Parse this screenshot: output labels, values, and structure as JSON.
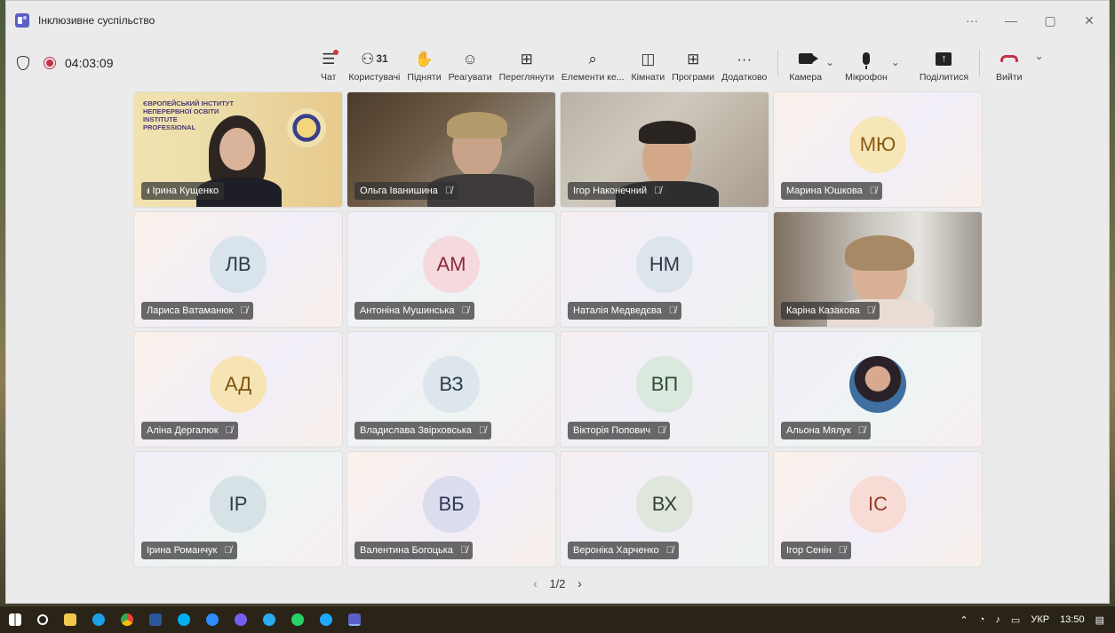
{
  "window": {
    "title": "Інклюзивне суспільство",
    "controls": {
      "more": "···",
      "minimize": "—",
      "maximize": "▢",
      "close": "✕"
    }
  },
  "meeting": {
    "timer": "04:03:09"
  },
  "toolbar": {
    "chat": "Чат",
    "people_count": "31",
    "people": "Користувачі",
    "raise": "Підняти",
    "react": "Реагувати",
    "view": "Переглянути",
    "elements": "Елементи ке...",
    "rooms": "Кімнати",
    "apps": "Програми",
    "more": "Додатково",
    "camera": "Камера",
    "mic": "Мікрофон",
    "share": "Поділитися",
    "leave": "Вийти"
  },
  "participants": [
    {
      "name": "Ірина Кущенко",
      "initials": "",
      "video": "irina",
      "signal": "ıl"
    },
    {
      "name": "Ольга Іванишина",
      "initials": "",
      "video": "olha"
    },
    {
      "name": "Ігор Наконечний",
      "initials": "",
      "video": "ihor"
    },
    {
      "name": "Марина Юшкова",
      "initials": "МЮ",
      "avatar_color": "#f7e6b8"
    },
    {
      "name": "Лариса Ватаманюк",
      "initials": "ЛВ",
      "avatar_color": "#d8e3ec"
    },
    {
      "name": "Антоніна Мушинська",
      "initials": "АМ",
      "avatar_color": "#f4d9dd"
    },
    {
      "name": "Наталія Медведєва",
      "initials": "НМ",
      "avatar_color": "#dde5ec"
    },
    {
      "name": "Каріна Казакова",
      "initials": "",
      "video": "karina"
    },
    {
      "name": "Аліна Дергалюк",
      "initials": "АД",
      "avatar_color": "#f7e4b4"
    },
    {
      "name": "Владислава Звірховська",
      "initials": "ВЗ",
      "avatar_color": "#dce6ec"
    },
    {
      "name": "Вікторія Попович",
      "initials": "ВП",
      "avatar_color": "#dbe8dd"
    },
    {
      "name": "Альона Мялук",
      "initials": "",
      "photo": true
    },
    {
      "name": "Ірина Романчук",
      "initials": "ІР",
      "avatar_color": "#d7e2e6"
    },
    {
      "name": "Валентина Богоцька",
      "initials": "ВБ",
      "avatar_color": "#dcdcef"
    },
    {
      "name": "Вероніка Харченко",
      "initials": "ВХ",
      "avatar_color": "#dfe6dc"
    },
    {
      "name": "Ігор Сенін",
      "initials": "ІС",
      "avatar_color": "#f6dcd5"
    }
  ],
  "pager": {
    "label": "1/2",
    "prev": "‹",
    "next": "›"
  },
  "taskbar": {
    "lang": "УКР",
    "time": "13:50",
    "apps": [
      "start",
      "search",
      "file-explorer",
      "edge",
      "chrome",
      "word",
      "skype",
      "zoom",
      "viber",
      "telegram",
      "whatsapp",
      "browser",
      "teams"
    ]
  }
}
